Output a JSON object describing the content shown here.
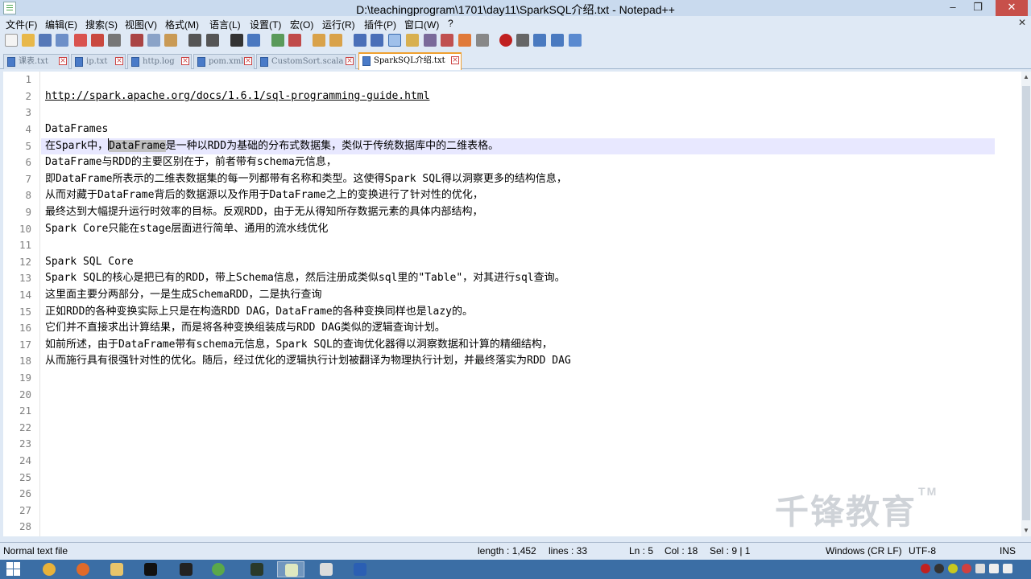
{
  "window": {
    "title": "D:\\teachingprogram\\1701\\day11\\SparkSQL介绍.txt - Notepad++",
    "minimize": "‒",
    "restore": "❐",
    "close": "✕"
  },
  "menu": {
    "items": [
      "文件(F)",
      "编辑(E)",
      "搜索(S)",
      "视图(V)",
      "格式(M)",
      "语言(L)",
      "设置(T)",
      "宏(O)",
      "运行(R)",
      "插件(P)",
      "窗口(W)",
      "?"
    ],
    "close_glyph": "✕"
  },
  "tabs": [
    {
      "label": "课表.txt",
      "active": false
    },
    {
      "label": "ip.txt",
      "active": false
    },
    {
      "label": "http.log",
      "active": false
    },
    {
      "label": "pom.xml",
      "active": false
    },
    {
      "label": "CustomSort.scala",
      "active": false
    },
    {
      "label": "SparkSQL介绍.txt",
      "active": true
    }
  ],
  "editor": {
    "line_numbers": [
      "1",
      "2",
      "3",
      "4",
      "5",
      "6",
      "7",
      "8",
      "9",
      "10",
      "11",
      "12",
      "13",
      "14",
      "15",
      "16",
      "17",
      "18",
      "19",
      "20",
      "21",
      "22",
      "23",
      "24",
      "25",
      "26",
      "27",
      "28"
    ],
    "lines": {
      "l2": "http://spark.apache.org/docs/1.6.1/sql-programming-guide.html",
      "l4": "DataFrames",
      "l5_pre": "在Spark中，",
      "l5_sel": "DataFrame",
      "l5_post": "是一种以RDD为基础的分布式数据集，类似于传统数据库中的二维表格。",
      "l6": "DataFrame与RDD的主要区别在于，前者带有schema元信息，",
      "l7": "即DataFrame所表示的二维表数据集的每一列都带有名称和类型。这使得Spark SQL得以洞察更多的结构信息，",
      "l8": "从而对藏于DataFrame背后的数据源以及作用于DataFrame之上的变换进行了针对性的优化，",
      "l9": "最终达到大幅提升运行时效率的目标。反观RDD，由于无从得知所存数据元素的具体内部结构，",
      "l10": "Spark Core只能在stage层面进行简单、通用的流水线优化",
      "l12": "Spark SQL Core",
      "l13": "Spark SQL的核心是把已有的RDD，带上Schema信息，然后注册成类似sql里的\"Table\"，对其进行sql查询。",
      "l14": "这里面主要分两部分，一是生成SchemaRDD，二是执行查询",
      "l15": "正如RDD的各种变换实际上只是在构造RDD DAG，DataFrame的各种变换同样也是lazy的。",
      "l16": "它们并不直接求出计算结果，而是将各种变换组装成与RDD DAG类似的逻辑查询计划。",
      "l17": "如前所述，由于DataFrame带有schema元信息，Spark SQL的查询优化器得以洞察数据和计算的精细结构，",
      "l18": "从而施行具有很强针对性的优化。随后，经过优化的逻辑执行计划被翻译为物理执行计划，并最终落实为RDD DAG"
    }
  },
  "watermark": {
    "text": "千锋教育",
    "tm": "TM"
  },
  "status": {
    "file_type": "Normal text file",
    "length": "length : 1,452",
    "lines": "lines : 33",
    "ln": "Ln : 5",
    "col": "Col : 18",
    "sel": "Sel : 9 | 1",
    "eol": "Windows (CR LF)",
    "encoding": "UTF-8",
    "mode": "INS"
  },
  "colors": {
    "accent_tab": "#f0a030",
    "current_line": "#e8e8ff",
    "selection": "#c0c0c0",
    "taskbar": "#3b6ea5"
  }
}
